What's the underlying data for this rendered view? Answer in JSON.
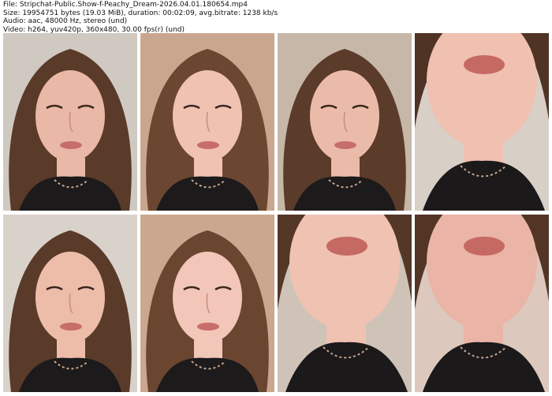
{
  "header": {
    "file_line": "File: Stripchat-Public.Show-f-Peachy_Dream-2026.04.01.180654.mp4",
    "size_line": "Size: 19954751 bytes (19.03 MiB), duration: 00:02:09, avg.bitrate: 1238 kb/s",
    "audio_line": "Audio: aac, 48000 Hz, stereo (und)",
    "video_line": "Video: h264, yuv420p, 360x480, 30.00 fps(r) (und)"
  },
  "thumbnails": [
    {
      "kind": "face",
      "bg": "#cfc9c2",
      "hair": "#5a3a28",
      "skin": "#e9b8a6"
    },
    {
      "kind": "face",
      "bg": "#c9a78f",
      "hair": "#6b4630",
      "skin": "#f0c2b2"
    },
    {
      "kind": "face",
      "bg": "#c6b7a8",
      "hair": "#5b3b2a",
      "skin": "#ebbbaa"
    },
    {
      "kind": "closeup",
      "bg": "#d8cfc7",
      "hair": "#4f3325",
      "skin": "#f0c0b0"
    },
    {
      "kind": "face",
      "bg": "#d9d2cb",
      "hair": "#5a3a28",
      "skin": "#edbdaa"
    },
    {
      "kind": "face",
      "bg": "#caa88f",
      "hair": "#6a4530",
      "skin": "#f2c6b8"
    },
    {
      "kind": "closeup",
      "bg": "#cfc3b8",
      "hair": "#553727",
      "skin": "#f0c2b2"
    },
    {
      "kind": "closeup",
      "bg": "#dcc8bd",
      "hair": "#533526",
      "skin": "#eab4a6"
    }
  ]
}
